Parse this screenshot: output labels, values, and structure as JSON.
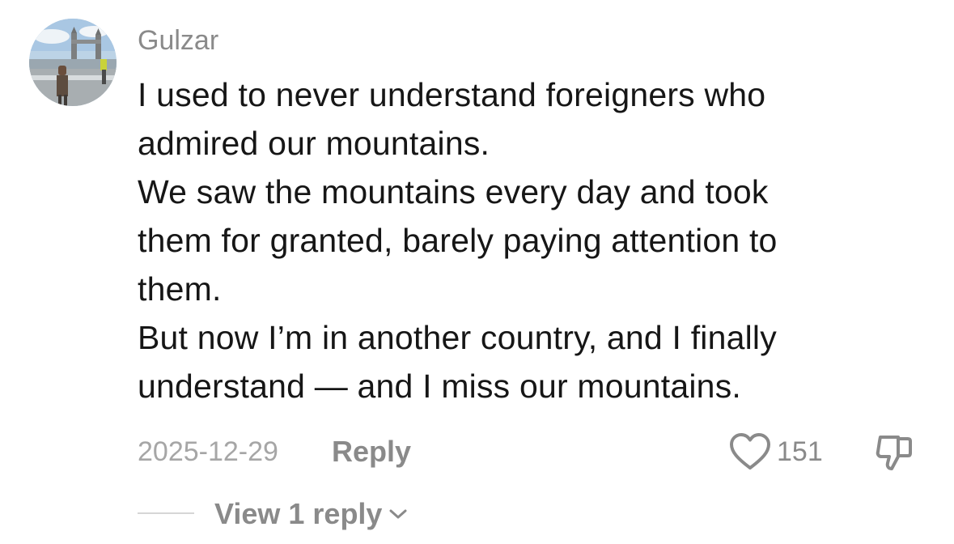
{
  "comment": {
    "username": "Gulzar",
    "avatar_icon": "profile-photo",
    "body_lines": [
      "I used to never understand foreigners who",
      "admired our mountains.",
      "We saw the mountains every day and took",
      "them for granted, barely paying attention to",
      "them.",
      "But now I’m in another country, and I finally",
      "understand — and I miss our mountains."
    ],
    "date": "2025-12-29",
    "reply_label": "Reply",
    "like_icon": "heart-outline-icon",
    "like_count": "151",
    "dislike_icon": "thumbs-down-icon",
    "view_replies_label": "View 1 reply",
    "view_replies_icon": "chevron-down-icon"
  },
  "colors": {
    "text_primary": "#161616",
    "text_secondary": "#8a8a8a",
    "text_tertiary": "#a6a6a6",
    "background": "#ffffff"
  }
}
